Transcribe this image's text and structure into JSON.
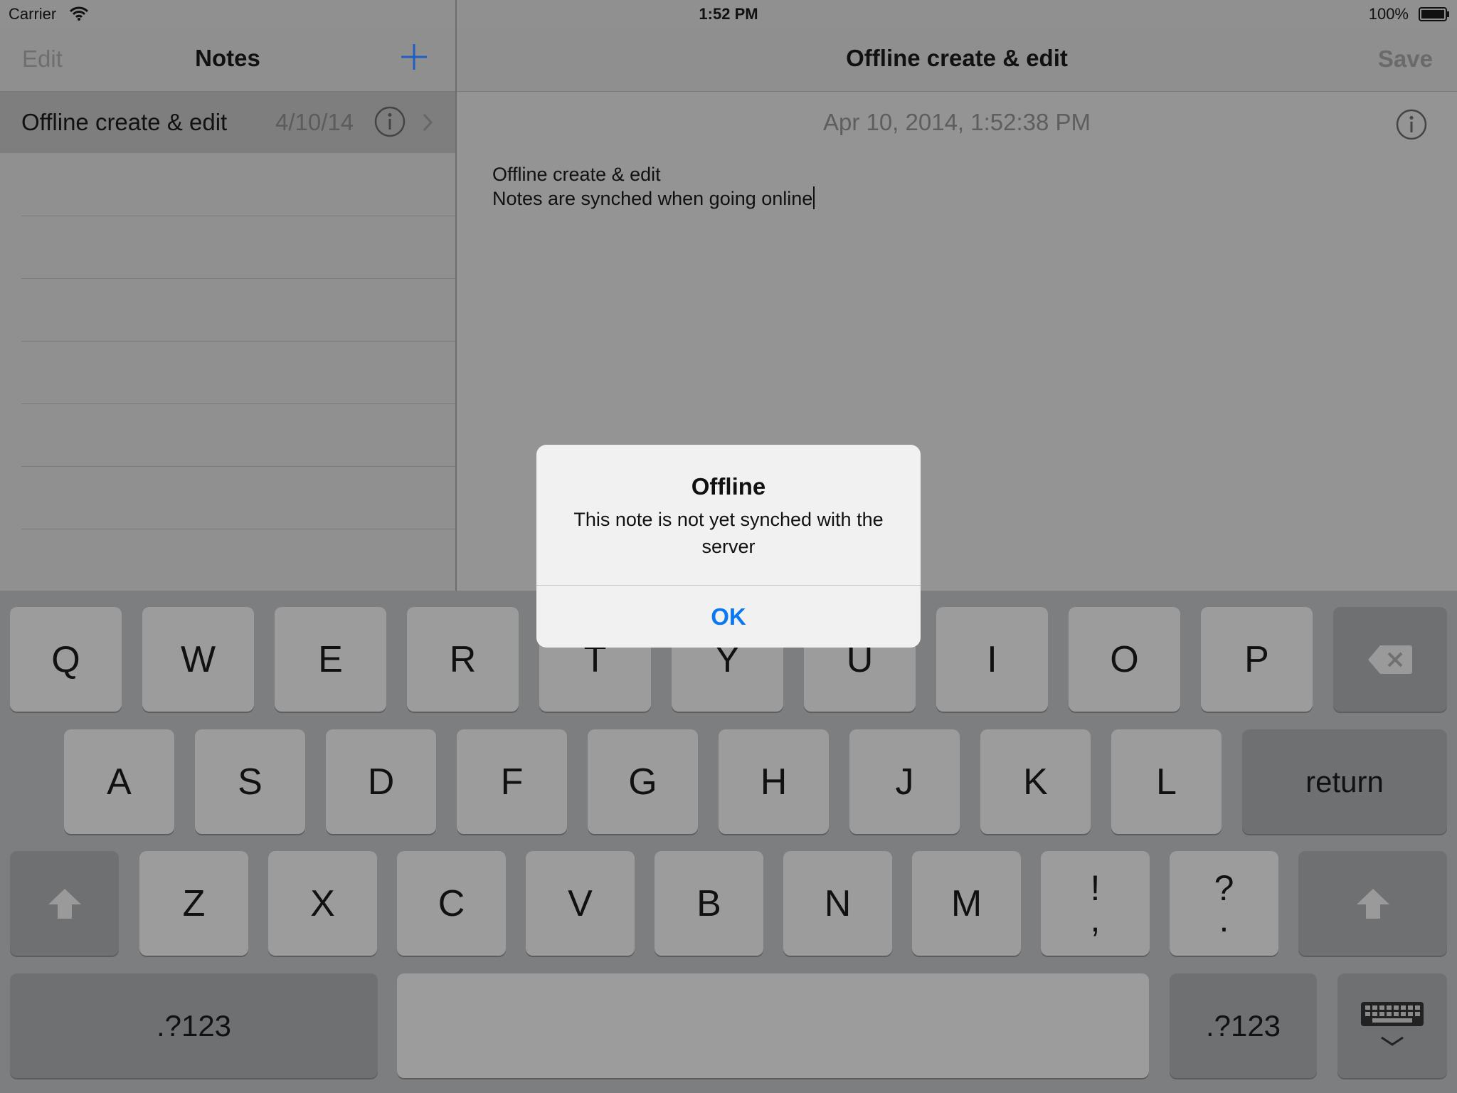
{
  "status_bar": {
    "carrier": "Carrier",
    "time": "1:52 PM",
    "battery": "100%"
  },
  "master": {
    "edit_label": "Edit",
    "title": "Notes",
    "add_icon": "plus-icon",
    "notes": [
      {
        "title": "Offline create & edit",
        "date": "4/10/14"
      }
    ]
  },
  "detail": {
    "title": "Offline create & edit",
    "save_label": "Save",
    "timestamp": "Apr 10, 2014, 1:52:38 PM",
    "body_line1": "Offline create & edit",
    "body_line2": "Notes are synched when going online"
  },
  "alert": {
    "title": "Offline",
    "message": "This note is not yet synched with the server",
    "ok_label": "OK"
  },
  "keyboard": {
    "row1": [
      "Q",
      "W",
      "E",
      "R",
      "T",
      "Y",
      "U",
      "I",
      "O",
      "P"
    ],
    "row2": [
      "A",
      "S",
      "D",
      "F",
      "G",
      "H",
      "J",
      "K",
      "L"
    ],
    "return_label": "return",
    "row3": [
      "Z",
      "X",
      "C",
      "V",
      "B",
      "N",
      "M"
    ],
    "punct1_top": "!",
    "punct1_bottom": ",",
    "punct2_top": "?",
    "punct2_bottom": ".",
    "numbers_label": ".?123",
    "accent_color": "#0a78f0"
  }
}
